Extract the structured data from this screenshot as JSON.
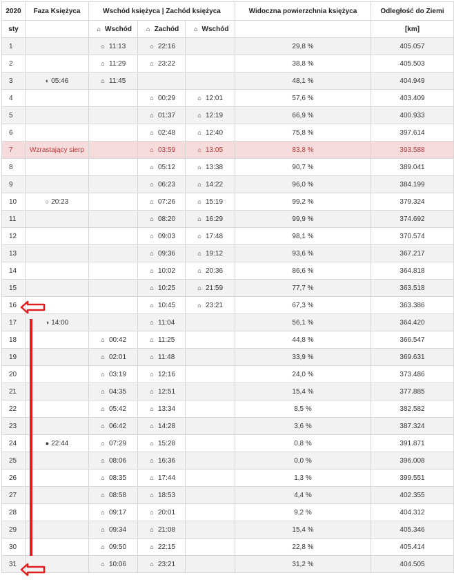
{
  "header": {
    "year": "2020",
    "phase_col": "Faza Księżyca",
    "riseset_col": "Wschód księżyca | Zachód księżyca",
    "visible_col": "Widoczna powierzchnia księżyca",
    "distance_col": "Odległość do Ziemi",
    "month": "sty",
    "sub_rise1": "Wschód",
    "sub_set": "Zachód",
    "sub_rise2": "Wschód",
    "unit": "[km]"
  },
  "colors": {
    "highlight_bg": "#f5dbdc",
    "highlight_text": "#b73b3b",
    "annotation": "#e02020"
  },
  "icons": {
    "moonrise": "moonrise-icon",
    "moonset": "moonset-icon"
  },
  "rows": [
    {
      "day": "1",
      "phase": "",
      "phase_icon": "",
      "r1": "11:13",
      "s": "22:16",
      "r2": "",
      "vis": "29,8 %",
      "dist": "405.057"
    },
    {
      "day": "2",
      "phase": "",
      "phase_icon": "",
      "r1": "11:29",
      "s": "23:22",
      "r2": "",
      "vis": "38,8 %",
      "dist": "405.503"
    },
    {
      "day": "3",
      "phase": "05:46",
      "phase_icon": "◐",
      "r1": "11:45",
      "s": "",
      "r2": "",
      "vis": "48,1 %",
      "dist": "404.949"
    },
    {
      "day": "4",
      "phase": "",
      "phase_icon": "",
      "r1": "",
      "s": "00:29",
      "r2": "12:01",
      "vis": "57,6 %",
      "dist": "403.409"
    },
    {
      "day": "5",
      "phase": "",
      "phase_icon": "",
      "r1": "",
      "s": "01:37",
      "r2": "12:19",
      "vis": "66,9 %",
      "dist": "400.933"
    },
    {
      "day": "6",
      "phase": "",
      "phase_icon": "",
      "r1": "",
      "s": "02:48",
      "r2": "12:40",
      "vis": "75,8 %",
      "dist": "397.614"
    },
    {
      "day": "7",
      "phase": "Wzrastający sierp",
      "phase_icon": "",
      "r1": "",
      "s": "03:59",
      "r2": "13:05",
      "vis": "83,8 %",
      "dist": "393.588",
      "hl": true
    },
    {
      "day": "8",
      "phase": "",
      "phase_icon": "",
      "r1": "",
      "s": "05:12",
      "r2": "13:38",
      "vis": "90,7 %",
      "dist": "389.041"
    },
    {
      "day": "9",
      "phase": "",
      "phase_icon": "",
      "r1": "",
      "s": "06:23",
      "r2": "14:22",
      "vis": "96,0 %",
      "dist": "384.199"
    },
    {
      "day": "10",
      "phase": "20:23",
      "phase_icon": "○",
      "r1": "",
      "s": "07:26",
      "r2": "15:19",
      "vis": "99,2 %",
      "dist": "379.324"
    },
    {
      "day": "11",
      "phase": "",
      "phase_icon": "",
      "r1": "",
      "s": "08:20",
      "r2": "16:29",
      "vis": "99,9 %",
      "dist": "374.692"
    },
    {
      "day": "12",
      "phase": "",
      "phase_icon": "",
      "r1": "",
      "s": "09:03",
      "r2": "17:48",
      "vis": "98,1 %",
      "dist": "370.574"
    },
    {
      "day": "13",
      "phase": "",
      "phase_icon": "",
      "r1": "",
      "s": "09:36",
      "r2": "19:12",
      "vis": "93,6 %",
      "dist": "367.217"
    },
    {
      "day": "14",
      "phase": "",
      "phase_icon": "",
      "r1": "",
      "s": "10:02",
      "r2": "20:36",
      "vis": "86,6 %",
      "dist": "364.818"
    },
    {
      "day": "15",
      "phase": "",
      "phase_icon": "",
      "r1": "",
      "s": "10:25",
      "r2": "21:59",
      "vis": "77,7 %",
      "dist": "363.518"
    },
    {
      "day": "16",
      "phase": "",
      "phase_icon": "",
      "r1": "",
      "s": "10:45",
      "r2": "23:21",
      "vis": "67,3 %",
      "dist": "363.386"
    },
    {
      "day": "17",
      "phase": "14:00",
      "phase_icon": "◑",
      "r1": "",
      "s": "11:04",
      "r2": "",
      "vis": "56,1 %",
      "dist": "364.420"
    },
    {
      "day": "18",
      "phase": "",
      "phase_icon": "",
      "r1": "00:42",
      "s": "11:25",
      "r2": "",
      "vis": "44,8 %",
      "dist": "366.547"
    },
    {
      "day": "19",
      "phase": "",
      "phase_icon": "",
      "r1": "02:01",
      "s": "11:48",
      "r2": "",
      "vis": "33,9 %",
      "dist": "369.631"
    },
    {
      "day": "20",
      "phase": "",
      "phase_icon": "",
      "r1": "03:19",
      "s": "12:16",
      "r2": "",
      "vis": "24,0 %",
      "dist": "373.486"
    },
    {
      "day": "21",
      "phase": "",
      "phase_icon": "",
      "r1": "04:35",
      "s": "12:51",
      "r2": "",
      "vis": "15,4 %",
      "dist": "377.885"
    },
    {
      "day": "22",
      "phase": "",
      "phase_icon": "",
      "r1": "05:42",
      "s": "13:34",
      "r2": "",
      "vis": "8,5 %",
      "dist": "382.582"
    },
    {
      "day": "23",
      "phase": "",
      "phase_icon": "",
      "r1": "06:42",
      "s": "14:28",
      "r2": "",
      "vis": "3,6 %",
      "dist": "387.324"
    },
    {
      "day": "24",
      "phase": "22:44",
      "phase_icon": "●",
      "r1": "07:29",
      "s": "15:28",
      "r2": "",
      "vis": "0,8 %",
      "dist": "391.871"
    },
    {
      "day": "25",
      "phase": "",
      "phase_icon": "",
      "r1": "08:06",
      "s": "16:36",
      "r2": "",
      "vis": "0,0 %",
      "dist": "396.008"
    },
    {
      "day": "26",
      "phase": "",
      "phase_icon": "",
      "r1": "08:35",
      "s": "17:44",
      "r2": "",
      "vis": "1,3 %",
      "dist": "399.551"
    },
    {
      "day": "27",
      "phase": "",
      "phase_icon": "",
      "r1": "08:58",
      "s": "18:53",
      "r2": "",
      "vis": "4,4 %",
      "dist": "402.355"
    },
    {
      "day": "28",
      "phase": "",
      "phase_icon": "",
      "r1": "09:17",
      "s": "20:01",
      "r2": "",
      "vis": "9,2 %",
      "dist": "404.312"
    },
    {
      "day": "29",
      "phase": "",
      "phase_icon": "",
      "r1": "09:34",
      "s": "21:08",
      "r2": "",
      "vis": "15,4 %",
      "dist": "405.346"
    },
    {
      "day": "30",
      "phase": "",
      "phase_icon": "",
      "r1": "09:50",
      "s": "22:15",
      "r2": "",
      "vis": "22,8 %",
      "dist": "405.414"
    },
    {
      "day": "31",
      "phase": "",
      "phase_icon": "",
      "r1": "10:06",
      "s": "23:21",
      "r2": "",
      "vis": "31,2 %",
      "dist": "404.505"
    }
  ]
}
